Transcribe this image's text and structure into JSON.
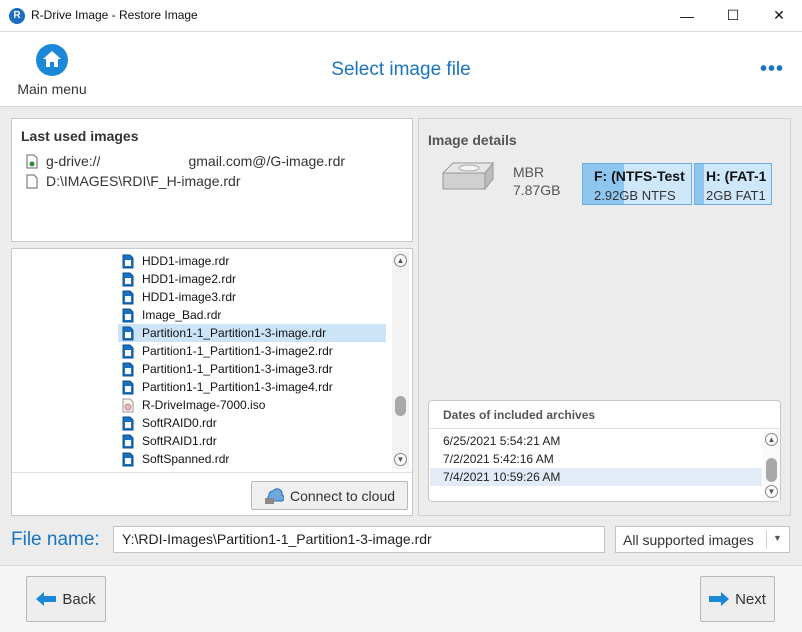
{
  "window": {
    "title": "R-Drive Image - Restore Image",
    "app_icon_letter": "R",
    "minimize_glyph": "—",
    "maximize_glyph": "☐",
    "close_glyph": "✕"
  },
  "header": {
    "main_menu_label": "Main menu",
    "page_title": "Select image file",
    "more_glyph": "•••"
  },
  "last_used": {
    "heading": "Last used images",
    "items": [
      {
        "prefix": "g-drive://",
        "suffix": "gmail.com@/G-image.rdr"
      },
      {
        "prefix": "D:\\IMAGES\\RDI\\F_H-image.rdr",
        "suffix": ""
      }
    ]
  },
  "file_list": {
    "files": [
      {
        "name": "HDD1-image.rdr",
        "icon": "rdr-file-icon"
      },
      {
        "name": "HDD1-image2.rdr",
        "icon": "rdr-file-icon"
      },
      {
        "name": "HDD1-image3.rdr",
        "icon": "rdr-file-icon"
      },
      {
        "name": "Image_Bad.rdr",
        "icon": "rdr-file-icon"
      },
      {
        "name": "Partition1-1_Partition1-3-image.rdr",
        "icon": "rdr-file-icon",
        "selected": true
      },
      {
        "name": "Partition1-1_Partition1-3-image2.rdr",
        "icon": "rdr-file-icon"
      },
      {
        "name": "Partition1-1_Partition1-3-image3.rdr",
        "icon": "rdr-file-icon"
      },
      {
        "name": "Partition1-1_Partition1-3-image4.rdr",
        "icon": "rdr-file-icon"
      },
      {
        "name": "R-DriveImage-7000.iso",
        "icon": "iso-file-icon"
      },
      {
        "name": "SoftRAID0.rdr",
        "icon": "rdr-file-icon"
      },
      {
        "name": "SoftRAID1.rdr",
        "icon": "rdr-file-icon"
      },
      {
        "name": "SoftSpanned.rdr",
        "icon": "rdr-file-icon"
      }
    ],
    "connect_cloud_label": "Connect to cloud"
  },
  "image_details": {
    "heading": "Image details",
    "disk_type": "MBR",
    "disk_size": "7.87GB",
    "partitions": [
      {
        "name": "F: (NTFS-Test",
        "info": "2.92GB NTFS",
        "used_fraction": 0.38
      },
      {
        "name": "H: (FAT-1",
        "info": "2GB FAT1",
        "used_fraction": 0.12
      }
    ],
    "dates_heading": "Dates of included archives",
    "dates": [
      {
        "value": "6/25/2021 5:54:21 AM",
        "selected": false
      },
      {
        "value": "7/2/2021 5:42:16 AM",
        "selected": false
      },
      {
        "value": "7/4/2021 10:59:26 AM",
        "selected": true
      }
    ]
  },
  "file_name": {
    "label": "File name:",
    "value": "Y:\\RDI-Images\\Partition1-1_Partition1-3-image.rdr",
    "filter": "All supported images"
  },
  "footer": {
    "back_label": "Back",
    "next_label": "Next"
  },
  "colors": {
    "accent": "#1b74c0",
    "selection": "#cce4f7",
    "partition_fill": "#8ec6f0"
  }
}
